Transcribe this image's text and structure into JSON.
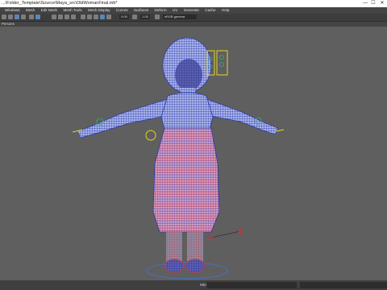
{
  "window": {
    "title": "...\\Folder_Template\\Source\\Maya_src\\OldWomanFinal.mb*",
    "controls": [
      "—",
      "☐",
      "✕"
    ]
  },
  "menu": [
    "Windows",
    "Mesh",
    "Edit Mesh",
    "Mesh Tools",
    "Mesh Display",
    "Curves",
    "Surfaces",
    "Deform",
    "UV",
    "Generate",
    "Cache",
    "Help"
  ],
  "toolbar": {
    "value_a": "0.00",
    "value_b": "1.00",
    "color_space": "sRGB gamma"
  },
  "panel": {
    "label": "Persons"
  },
  "status": {
    "mel_label": "MEL"
  },
  "icons": [
    "lasso-select-icon",
    "move-tool-icon",
    "camera-icon",
    "grid-icon",
    "shaded-icon",
    "wireframe-icon",
    "light-icon",
    "isolate-icon"
  ]
}
